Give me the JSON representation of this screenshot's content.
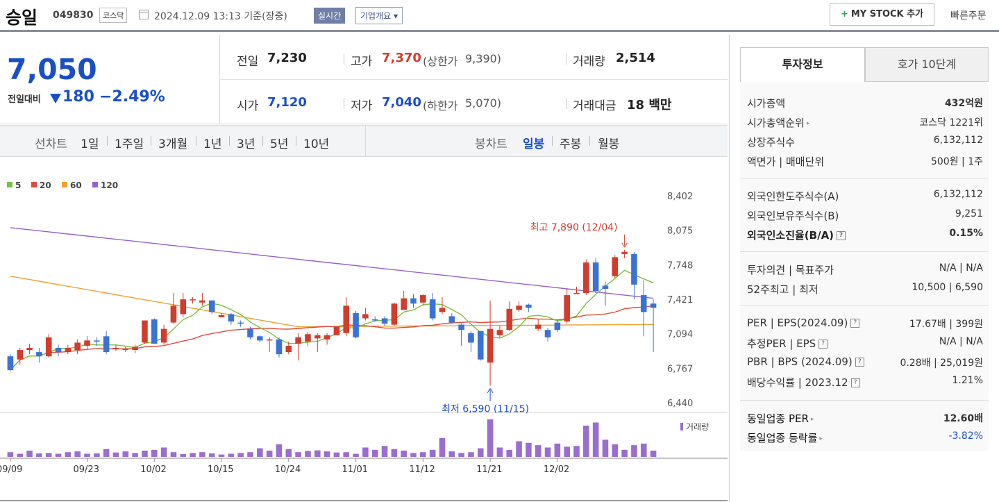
{
  "header": {
    "stock_name": "승일",
    "stock_code": "049830",
    "market": "코스닥",
    "datetime": "2024.12.09 13:13  기준(장중)",
    "realtime": "실시간",
    "company_overview": "기업개요 ▾",
    "mystock_add": "MY STOCK 추가",
    "quick_order": "빠른주문"
  },
  "quote": {
    "price": "7,050",
    "change_label": "전일대비",
    "change_value": "180",
    "change_rate": "−2.49%",
    "prev_close_label": "전일",
    "prev_close": "7,230",
    "high_label": "고가",
    "high": "7,370",
    "upper_limit_label": "(상한가",
    "upper_limit": "9,390)",
    "volume_label": "거래량",
    "volume": "2,514",
    "open_label": "시가",
    "open": "7,120",
    "low_label": "저가",
    "low": "7,040",
    "lower_limit_label": "(하한가",
    "lower_limit": "5,070)",
    "amount_label": "거래대금",
    "amount": "18 백만"
  },
  "tabs": {
    "line_chart": "선차트",
    "periods": [
      "1일",
      "1주일",
      "3개월",
      "1년",
      "3년",
      "5년",
      "10년"
    ],
    "candle_chart": "봉차트",
    "candle_periods": [
      "일봉",
      "주봉",
      "월봉"
    ],
    "active_candle": "일봉"
  },
  "colors": {
    "up": "#d23c2c",
    "down": "#3a72d6",
    "ma5": "#7bc043",
    "ma20": "#e04a3a",
    "ma60": "#f0a030",
    "ma120": "#9a5fd0",
    "volume": "#9a6dd0"
  },
  "chart_data": {
    "type": "candlestick",
    "legend": [
      {
        "name": "5",
        "color": "#7bc043"
      },
      {
        "name": "20",
        "color": "#e04a3a"
      },
      {
        "name": "60",
        "color": "#f0a030"
      },
      {
        "name": "120",
        "color": "#9a5fd0"
      }
    ],
    "y_ticks": [
      "8,402",
      "8,075",
      "7,748",
      "7,421",
      "7,094",
      "6,767",
      "6,440"
    ],
    "ylim": [
      6440,
      8402
    ],
    "x_ticks": [
      {
        "label": "09/09",
        "i": 0
      },
      {
        "label": "09/23",
        "i": 8
      },
      {
        "label": "10/02",
        "i": 15
      },
      {
        "label": "10/15",
        "i": 22
      },
      {
        "label": "10/24",
        "i": 29
      },
      {
        "label": "11/01",
        "i": 36
      },
      {
        "label": "11/12",
        "i": 43
      },
      {
        "label": "11/21",
        "i": 50
      },
      {
        "label": "12/02",
        "i": 57
      }
    ],
    "max_label": "최고 7,890 (12/04)",
    "min_label": "최저 6,590 (11/15)",
    "volume_label": "거래량",
    "candles": [
      [
        6880,
        6750,
        6900,
        6740
      ],
      [
        6850,
        6940,
        6960,
        6800
      ],
      [
        6940,
        6960,
        7000,
        6900
      ],
      [
        6920,
        6880,
        6960,
        6820
      ],
      [
        6880,
        7060,
        7090,
        6870
      ],
      [
        6960,
        6920,
        6990,
        6880
      ],
      [
        6920,
        6960,
        6990,
        6900
      ],
      [
        6940,
        7010,
        7040,
        6900
      ],
      [
        6980,
        7030,
        7070,
        6950
      ],
      [
        7030,
        7020,
        7060,
        6980
      ],
      [
        7070,
        6920,
        7120,
        6900
      ],
      [
        6950,
        6960,
        6990,
        6930
      ],
      [
        6950,
        6950,
        6970,
        6920
      ],
      [
        6940,
        6970,
        6990,
        6910
      ],
      [
        7010,
        7220,
        7220,
        7000
      ],
      [
        7230,
        7000,
        7240,
        7000
      ],
      [
        7010,
        7140,
        7180,
        6990
      ],
      [
        7200,
        7360,
        7480,
        7190
      ],
      [
        7280,
        7420,
        7480,
        7250
      ],
      [
        7420,
        7420,
        7440,
        7380
      ],
      [
        7390,
        7410,
        7480,
        7360
      ],
      [
        7410,
        7300,
        7410,
        7280
      ],
      [
        7250,
        7270,
        7290,
        7250
      ],
      [
        7280,
        7210,
        7290,
        7180
      ],
      [
        7200,
        7190,
        7220,
        7160
      ],
      [
        7140,
        7060,
        7160,
        7040
      ],
      [
        7070,
        7030,
        7080,
        7010
      ],
      [
        7030,
        7040,
        7060,
        6920
      ],
      [
        7040,
        6900,
        7060,
        6870
      ],
      [
        6920,
        6980,
        7020,
        6900
      ],
      [
        7000,
        7060,
        7100,
        6840
      ],
      [
        7020,
        7090,
        7110,
        6980
      ],
      [
        7050,
        7080,
        7100,
        6920
      ],
      [
        7040,
        7080,
        7100,
        6990
      ],
      [
        7080,
        7160,
        7160,
        7080
      ],
      [
        7100,
        7360,
        7440,
        7070
      ],
      [
        7290,
        7060,
        7310,
        7050
      ],
      [
        7240,
        7280,
        7340,
        7220
      ],
      [
        7230,
        7220,
        7260,
        7210
      ],
      [
        7240,
        7190,
        7260,
        7170
      ],
      [
        7180,
        7380,
        7390,
        7170
      ],
      [
        7320,
        7430,
        7500,
        7320
      ],
      [
        7430,
        7380,
        7470,
        7340
      ],
      [
        7390,
        7460,
        7470,
        7360
      ],
      [
        7420,
        7240,
        7480,
        7220
      ],
      [
        7300,
        7340,
        7440,
        7280
      ],
      [
        7260,
        7200,
        7290,
        7190
      ],
      [
        7180,
        7130,
        7190,
        6980
      ],
      [
        7100,
        7010,
        7120,
        6920
      ],
      [
        7120,
        6850,
        7120,
        6840
      ],
      [
        6820,
        7140,
        7410,
        6600
      ],
      [
        7080,
        7130,
        7170,
        7060
      ],
      [
        7130,
        7330,
        7400,
        7120
      ],
      [
        7320,
        7360,
        7400,
        7300
      ],
      [
        7370,
        7340,
        7380,
        7300
      ],
      [
        7140,
        7180,
        7230,
        7120
      ],
      [
        7130,
        7060,
        7150,
        7020
      ],
      [
        7200,
        7130,
        7220,
        7110
      ],
      [
        7210,
        7460,
        7520,
        7190
      ],
      [
        7470,
        7480,
        7540,
        7470
      ],
      [
        7480,
        7770,
        7800,
        7460
      ],
      [
        7770,
        7500,
        7810,
        7480
      ],
      [
        7550,
        7520,
        7590,
        7360
      ],
      [
        7640,
        7820,
        7840,
        7620
      ],
      [
        7850,
        7870,
        7890,
        7810
      ],
      [
        7850,
        7560,
        7870,
        7420
      ],
      [
        7460,
        7300,
        7600,
        7070
      ],
      [
        7380,
        7340,
        7420,
        6920
      ]
    ],
    "volumes": [
      30,
      20,
      40,
      22,
      25,
      20,
      30,
      35,
      20,
      22,
      50,
      28,
      35,
      25,
      40,
      45,
      60,
      30,
      18,
      25,
      30,
      22,
      15,
      20,
      25,
      30,
      55,
      40,
      80,
      50,
      30,
      38,
      42,
      35,
      28,
      30,
      20,
      60,
      45,
      70,
      50,
      40,
      25,
      30,
      45,
      120,
      35,
      25,
      30,
      55,
      240,
      60,
      45,
      100,
      90,
      75,
      60,
      85,
      65,
      70,
      200,
      220,
      110,
      80,
      45,
      75,
      85,
      40
    ]
  },
  "invest_info": {
    "tab_on": "투자정보",
    "tab_off": "호가 10단계",
    "rows1": [
      {
        "label": "시가총액",
        "value": "432억원"
      },
      {
        "label": "시가총액순위",
        "value": "코스닥 1221위"
      },
      {
        "label": "상장주식수",
        "value": "6,132,112"
      },
      {
        "label": "액면가 | 매매단위",
        "value": "500원 | 1주"
      }
    ],
    "rows2": [
      {
        "label": "외국인한도주식수(A)",
        "value": "6,132,112"
      },
      {
        "label": "외국인보유주식수(B)",
        "value": "9,251"
      },
      {
        "label": "외국인소진율(B/A)",
        "value": "0.15%"
      }
    ],
    "rows3": [
      {
        "label": "투자의견 | 목표주가",
        "value": "N/A | N/A"
      },
      {
        "label": "52주최고 | 최저",
        "value": "10,500 | 6,590"
      }
    ],
    "rows4": [
      {
        "label": "PER | EPS(2024.09)",
        "value": "17.67배 | 399원"
      },
      {
        "label": "추정PER | EPS",
        "value": "N/A | N/A"
      },
      {
        "label": "PBR | BPS (2024.09)",
        "value": "0.28배 | 25,019원"
      },
      {
        "label": "배당수익률 | 2023.12",
        "value": "1.21%"
      }
    ],
    "rows5": [
      {
        "label": "동일업종 PER",
        "value": "12.60배"
      },
      {
        "label": "동일업종 등락률",
        "value": "-3.82%"
      }
    ]
  }
}
